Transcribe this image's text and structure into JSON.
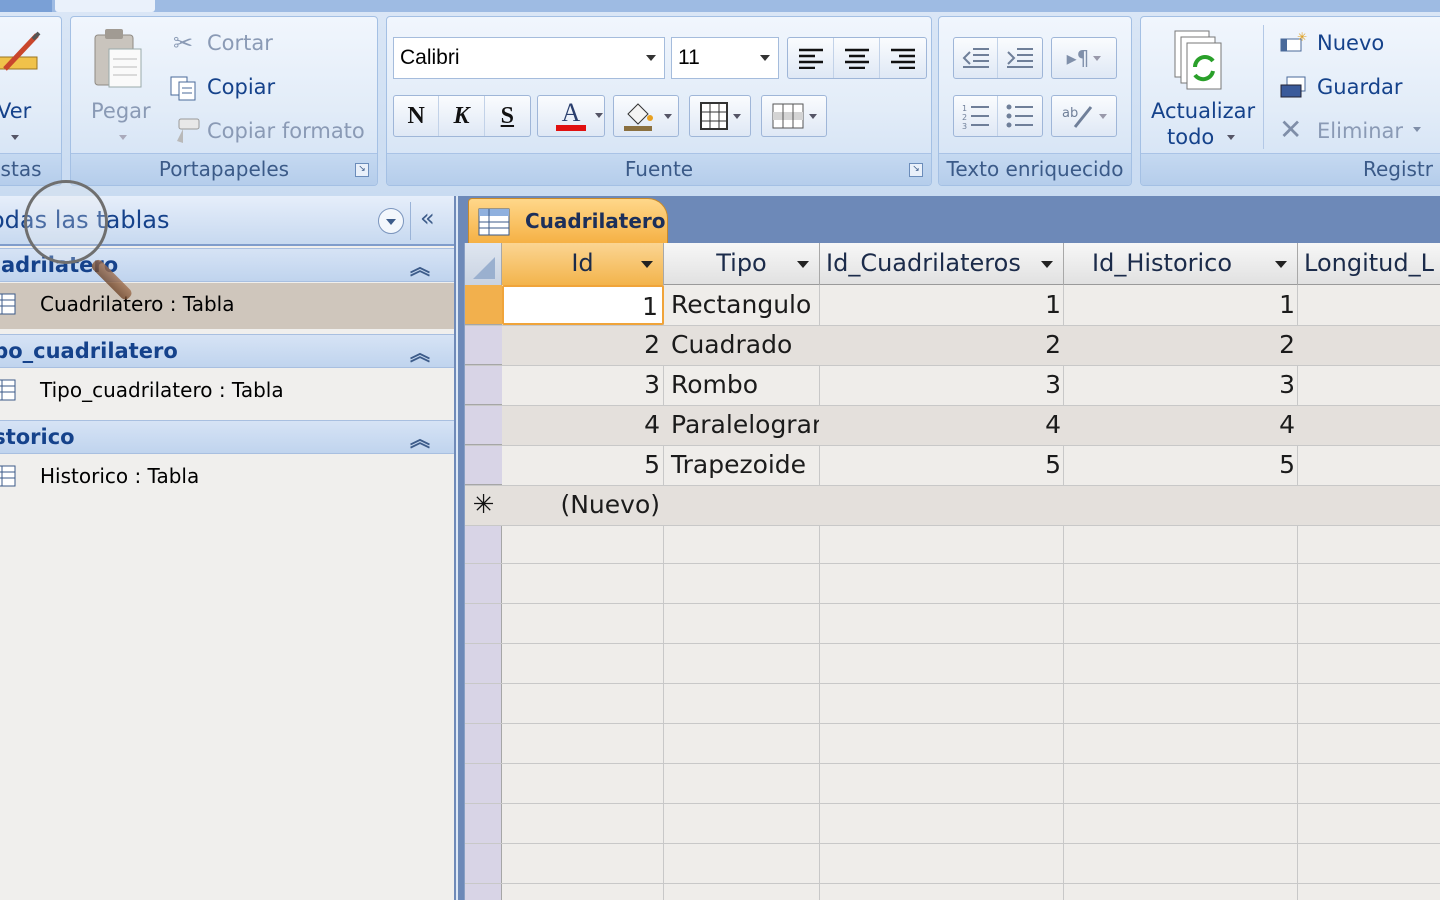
{
  "ribbon": {
    "vistas": {
      "ver_label": "Ver",
      "group_title": "istas"
    },
    "portapapeles": {
      "group_title": "Portapapeles",
      "paste_label": "Pegar",
      "cut_label": "Cortar",
      "copy_label": "Copiar",
      "format_painter_label": "Copiar formato"
    },
    "fuente": {
      "group_title": "Fuente",
      "font_name": "Calibri",
      "font_size": "11",
      "bold_label": "N",
      "italic_label": "K",
      "underline_label": "S",
      "font_color_letter": "A",
      "font_color": "#e01010"
    },
    "texto_enriquecido": {
      "group_title": "Texto enriquecido"
    },
    "registros": {
      "group_title": "Registr",
      "refresh_label_1": "Actualizar",
      "refresh_label_2": "todo",
      "new_label": "Nuevo",
      "save_label": "Guardar",
      "delete_label": "Eliminar"
    }
  },
  "nav": {
    "title": "odas las tablas",
    "groups": [
      {
        "name": "uadrilatero",
        "item": "Cuadrilatero : Tabla"
      },
      {
        "name": "ipo_cuadrilatero",
        "item": "Tipo_cuadrilatero : Tabla"
      },
      {
        "name": "istorico",
        "item": "Historico : Tabla"
      }
    ]
  },
  "document": {
    "tab_label": "Cuadrilatero",
    "columns": [
      "Id",
      "Tipo",
      "Id_Cuadrilateros",
      "Id_Historico",
      "Longitud_L"
    ],
    "rows": [
      [
        "1",
        "Rectangulo",
        "1",
        "1"
      ],
      [
        "2",
        "Cuadrado",
        "2",
        "2"
      ],
      [
        "3",
        "Rombo",
        "3",
        "3"
      ],
      [
        "4",
        "Paralelogramo",
        "4",
        "4"
      ],
      [
        "5",
        "Trapezoide",
        "5",
        "5"
      ]
    ],
    "new_row_label": "(Nuevo)",
    "new_row_marker": "✳"
  },
  "colors": {
    "ribbon_text": "#15428b",
    "active_header": "#f3b44c",
    "nav_selected": "#cfc6bc"
  }
}
